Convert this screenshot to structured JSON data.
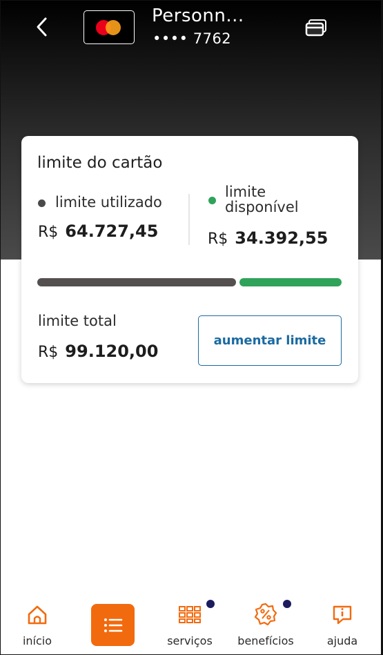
{
  "header": {
    "card_name": "Personn...",
    "card_number": "•••• 7762",
    "back_icon": "chevron-left-icon",
    "brand_icon": "mastercard-logo",
    "cards_icon": "cards-stack-icon"
  },
  "limit_card": {
    "title": "limite do cartão",
    "used": {
      "label": "limite utilizado",
      "currency": "R$",
      "value": "64.727,45",
      "color": "#4a4a4a"
    },
    "available": {
      "label": "limite disponível",
      "currency": "R$",
      "value": "34.392,55",
      "color": "#2fa35a"
    },
    "used_fraction": 0.653,
    "total": {
      "label": "limite total",
      "currency": "R$",
      "value": "99.120,00"
    },
    "raise_button": "aumentar limite"
  },
  "bottom_nav": {
    "items": [
      {
        "label": "início",
        "icon": "home-icon"
      },
      {
        "label": "",
        "icon": "menu-list-icon",
        "active": true
      },
      {
        "label": "serviços",
        "icon": "grid-icon",
        "badge": true
      },
      {
        "label": "benefícios",
        "icon": "percent-badge-icon",
        "badge": true
      },
      {
        "label": "ajuda",
        "icon": "help-info-icon"
      }
    ]
  },
  "colors": {
    "accent": "#f26a0e",
    "primary_blue": "#1a6aa0",
    "available_green": "#2fa35a",
    "used_gray": "#555050",
    "badge_navy": "#1b1b5e"
  }
}
